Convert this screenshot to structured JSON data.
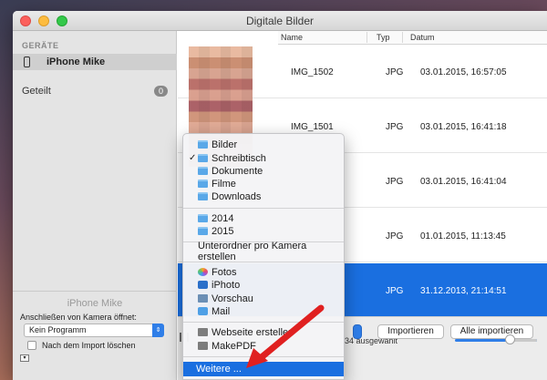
{
  "window": {
    "title": "Digitale Bilder"
  },
  "sidebar": {
    "heading": "GERÄTE",
    "device": "iPhone Mike",
    "shared_label": "Geteilt",
    "shared_count": "0",
    "device_name": "iPhone Mike",
    "connect_label": "Anschließen von Kamera öffnet:",
    "connect_value": "Kein Programm",
    "delete_after_import": "Nach dem Import löschen"
  },
  "columns": {
    "name": "Name",
    "type": "Typ",
    "date": "Datum",
    "extra": "Da"
  },
  "rows": [
    {
      "name": "IMG_1502",
      "type": "JPG",
      "date": "03.01.2015, 16:57:05"
    },
    {
      "name": "IMG_1501",
      "type": "JPG",
      "date": "03.01.2015, 16:41:18"
    },
    {
      "name": "",
      "type": "JPG",
      "date": "03.01.2015, 16:41:04"
    },
    {
      "name": "",
      "type": "JPG",
      "date": "01.01.2015, 11:13:45"
    },
    {
      "name": "",
      "type": "JPG",
      "date": "31.12.2013, 21:14:51",
      "selected": true
    }
  ],
  "bottom": {
    "selection_info": "34 ausgewählt",
    "import_button": "Importieren",
    "import_all_button": "Alle importieren",
    "zoom_level": 0.66
  },
  "menu": {
    "folders": [
      "Bilder",
      "Schreibtisch",
      "Dokumente",
      "Filme",
      "Downloads"
    ],
    "checked_folder": "Schreibtisch",
    "years": [
      "2014",
      "2015"
    ],
    "subfolder_option": "Unterordner pro Kamera erstellen",
    "apps": [
      "Fotos",
      "iPhoto",
      "Vorschau",
      "Mail"
    ],
    "scripts": [
      "Webseite erstellen",
      "MakePDF"
    ],
    "more": "Weitere ..."
  },
  "colors": {
    "accent": "#1a6fe0",
    "arrow": "#e02020"
  }
}
